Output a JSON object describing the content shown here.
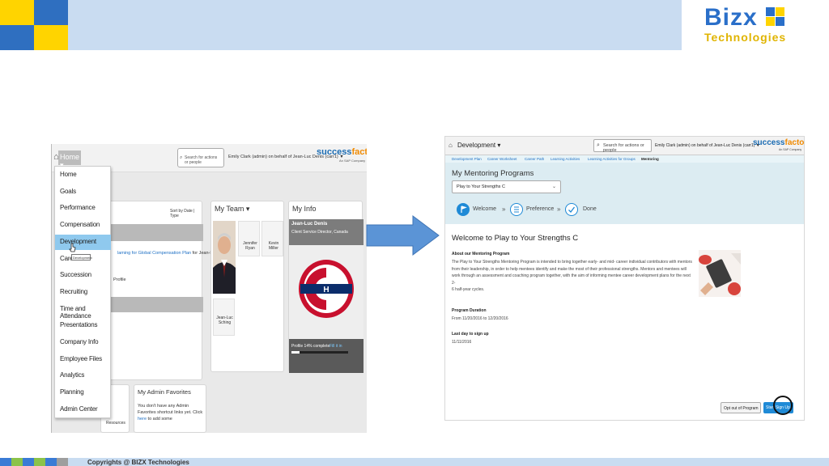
{
  "brand": {
    "logo_main": "Bizx",
    "logo_sub": "Technologies",
    "copyright": "Copyrights @ BIZX Technologies"
  },
  "colors": {
    "slide_band": "#c9dcf1",
    "brand_blue": "#2a6fc9",
    "brand_yellow": "#ffd400",
    "sf_blue": "#1b6cb3",
    "sf_orange": "#f08a00",
    "highlight": "#8fc9ee"
  },
  "left_screenshot": {
    "home_menu": "Home ▾",
    "search_placeholder": "Search for actions or people",
    "user_menu": "Emily Clark (admin) on behalf of Jean-Luc Denis (carr1) ▼",
    "sf_logo_a": "success",
    "sf_logo_b": "factors",
    "sf_tagline": "An SAP Company",
    "dropdown": [
      "Home",
      "Goals",
      "Performance",
      "Compensation",
      "Development",
      "Career",
      "Succession",
      "Recruiting",
      "Time and Attendance",
      "Presentations",
      "Company Info",
      "Employee Files",
      "Analytics",
      "Planning",
      "Admin Center"
    ],
    "highlighted_item": "Development",
    "tooltip": "Development",
    "todo_sort": "Sort by Date | Type",
    "todo_item_link": "laming for Global Compensation Plan",
    "todo_item_suffix": " for Jean-Luc Denis",
    "todo_profile_link": "Profile",
    "my_team_title": "My Team ▾",
    "team_members": [
      "Jennifer Ryan",
      "Kevin Miller",
      "Jean-Luc Sching"
    ],
    "my_info_title": "My Info",
    "my_info_name": "Jean-Luc Denis",
    "my_info_role": "Client Service Director, Canada",
    "profile_complete": "Profile 14% complete",
    "profile_fill_in": "Fill it in",
    "profile_percent": 14,
    "admin_fav_title": "My Admin Favorites",
    "admin_fav_text_a": "You don't have any Admin Favorites shortcut links yet. Click ",
    "admin_fav_link": "here",
    "admin_fav_text_b": " to add some",
    "resources_link": "Resources"
  },
  "right_screenshot": {
    "module_menu": "Development ▾",
    "search_placeholder": "Search for actions or people",
    "user_menu": "Emily Clark (admin) on behalf of Jean-Luc Denis (carr1) ▼",
    "sf_logo_a": "success",
    "sf_logo_b": "factors",
    "sf_tagline": "An SAP Company",
    "tabs": [
      "Development Plan",
      "Career Worksheet",
      "Career Path",
      "Learning Activities",
      "Learning Activities for Groups",
      "Mentoring"
    ],
    "active_tab": "Mentoring",
    "page_title": "My Mentoring Programs",
    "program_select": "Play to Your Strengths C",
    "steps": [
      "Welcome",
      "Preference",
      "Done"
    ],
    "welcome_heading": "Welcome to Play to Your Strengths C",
    "about_heading": "About our Mentoring Program",
    "about_text_lines": [
      "The Play to Your Strengths Mentoring Program is intended to bring together early- and mid- career individual contributors with mentors",
      "from their leadership, in order to help mentees identify and make the most of their professional strengths. Mentors and mentees will",
      "work through an assessment and coaching program together, with the aim of informing mentee career development plans for the next 2-",
      "6 half-year cycles."
    ],
    "duration_heading": "Program Duration",
    "duration_text": "From 11/20/2016 to 12/20/2016",
    "lastday_heading": "Last day to sign up",
    "lastday_text": "11/11/2016",
    "opt_out_button": "Opt out of Program",
    "sign_up_button": "Start Sign Up"
  }
}
